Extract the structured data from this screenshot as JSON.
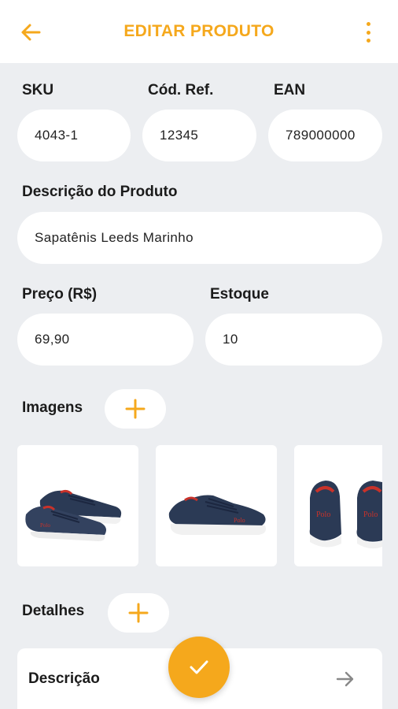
{
  "header": {
    "title": "EDITAR PRODUTO"
  },
  "form": {
    "sku": {
      "label": "SKU",
      "value": "4043-1"
    },
    "ref": {
      "label": "Cód. Ref.",
      "value": "12345"
    },
    "ean": {
      "label": "EAN",
      "value": "789000000"
    },
    "description": {
      "label": "Descrição do Produto",
      "value": "Sapatênis Leeds Marinho"
    },
    "price": {
      "label": "Preço (R$)",
      "value": "69,90"
    },
    "stock": {
      "label": "Estoque",
      "value": "10"
    }
  },
  "images": {
    "label": "Imagens",
    "items": [
      "navy-sneaker-pair-angled",
      "navy-sneaker-side",
      "navy-sneaker-rear"
    ]
  },
  "details": {
    "label": "Detalhes",
    "items": [
      {
        "label": "Descrição"
      }
    ]
  },
  "colors": {
    "accent": "#f5a81c",
    "background": "#eceef1",
    "card": "#ffffff",
    "shoe": "#2b3a55",
    "shoe_accent": "#c8322a"
  }
}
